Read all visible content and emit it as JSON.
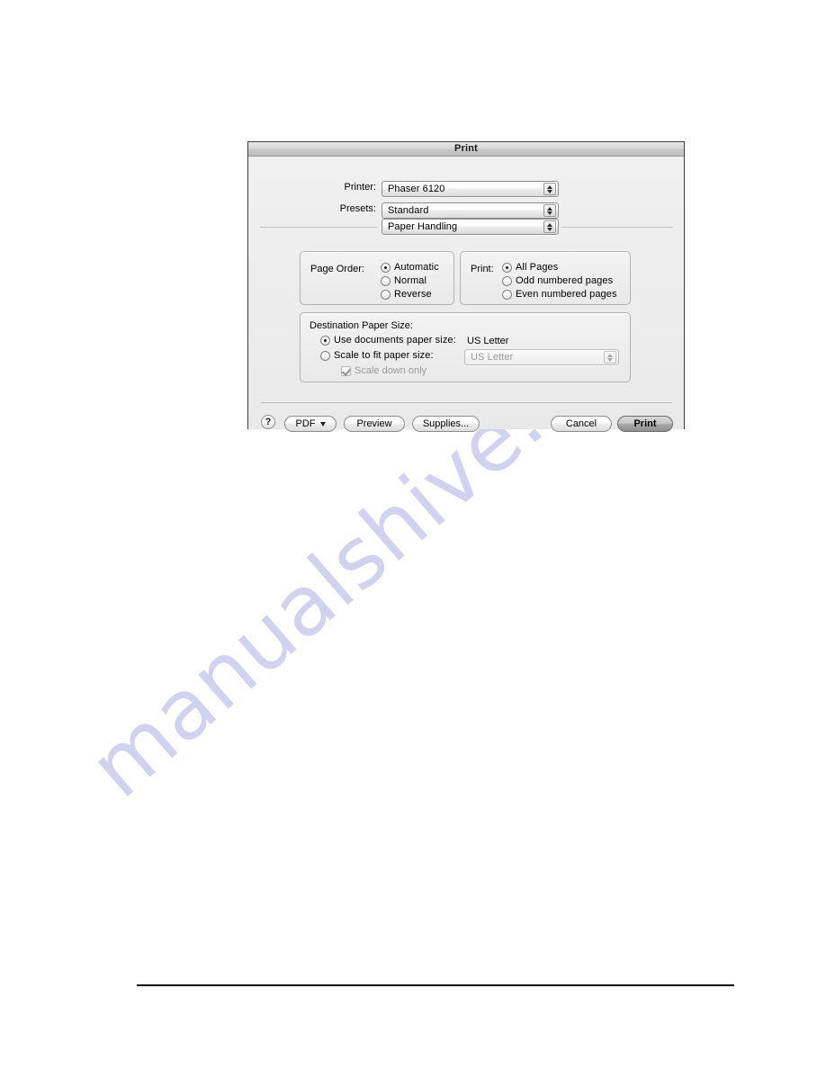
{
  "page": {
    "watermark": "manualshive.com"
  },
  "dialog": {
    "title": "Print",
    "printer": {
      "label": "Printer:",
      "value": "Phaser 6120"
    },
    "presets": {
      "label": "Presets:",
      "value": "Standard"
    },
    "pane": {
      "value": "Paper Handling"
    },
    "page_order": {
      "title": "Page Order:",
      "options": [
        {
          "label": "Automatic",
          "selected": true
        },
        {
          "label": "Normal",
          "selected": false
        },
        {
          "label": "Reverse",
          "selected": false
        }
      ]
    },
    "print_range": {
      "title": "Print:",
      "options": [
        {
          "label": "All Pages",
          "selected": true
        },
        {
          "label": "Odd numbered pages",
          "selected": false
        },
        {
          "label": "Even numbered pages",
          "selected": false
        }
      ]
    },
    "destination_paper_size": {
      "title": "Destination Paper Size:",
      "use_documents_label": "Use documents paper size:",
      "use_documents_value": "US Letter",
      "scale_to_fit_label": "Scale to fit paper size:",
      "scale_to_fit_value": "US Letter",
      "scale_down_only_label": "Scale down only"
    },
    "buttons": {
      "help": "?",
      "pdf": "PDF",
      "preview": "Preview",
      "supplies": "Supplies...",
      "cancel": "Cancel",
      "print": "Print"
    }
  }
}
